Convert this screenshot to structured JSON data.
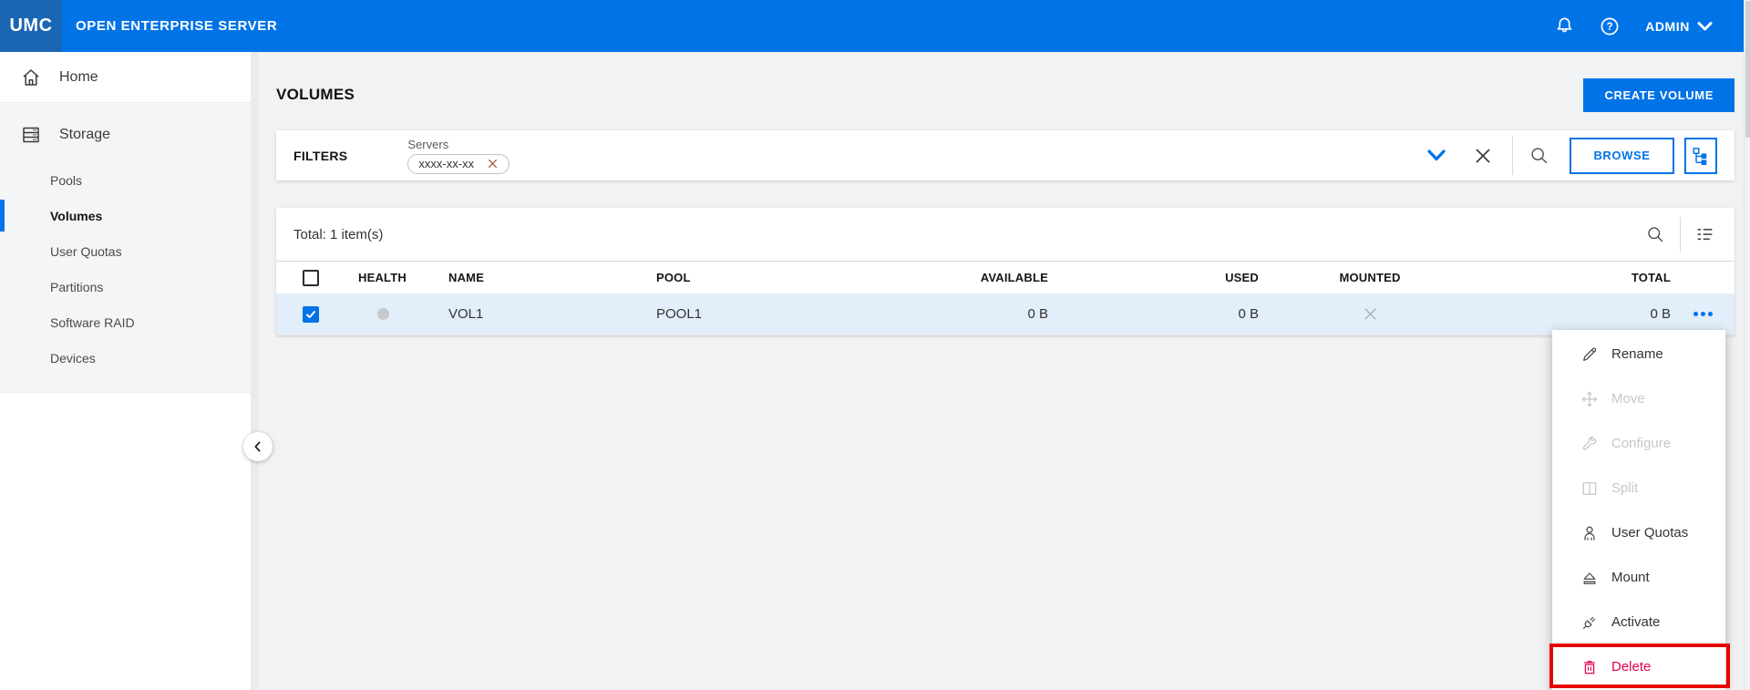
{
  "colors": {
    "accent": "#0073e7",
    "topbar": "#0073e7",
    "logo_bg": "#1a65b4",
    "danger": "#e5004c",
    "annotation": "#e60000",
    "row_selected": "#e2eef9",
    "main_bg": "#f1f2f4",
    "section_bg": "#f4f5f7"
  },
  "topbar": {
    "logo": "UMC",
    "product": "OPEN ENTERPRISE SERVER",
    "user": "ADMIN"
  },
  "sidebar": {
    "home_label": "Home",
    "sections": [
      {
        "label": "Storage",
        "items": [
          {
            "label": "Pools",
            "active": false
          },
          {
            "label": "Volumes",
            "active": true
          },
          {
            "label": "User Quotas",
            "active": false
          },
          {
            "label": "Partitions",
            "active": false
          },
          {
            "label": "Software RAID",
            "active": false
          },
          {
            "label": "Devices",
            "active": false
          }
        ]
      }
    ]
  },
  "page": {
    "title": "VOLUMES",
    "create_button": "CREATE VOLUME"
  },
  "filters": {
    "label": "FILTERS",
    "group_label": "Servers",
    "chip_value": "xxxx-xx-xx",
    "browse_button": "BROWSE"
  },
  "table": {
    "total": "Total: 1 item(s)",
    "columns": [
      "HEALTH",
      "NAME",
      "POOL",
      "AVAILABLE",
      "USED",
      "MOUNTED",
      "TOTAL"
    ],
    "rows": [
      {
        "selected": true,
        "health": "unknown",
        "name": "VOL1",
        "pool": "POOL1",
        "available": "0 B",
        "used": "0 B",
        "mounted": false,
        "total": "0 B"
      }
    ]
  },
  "context_menu": {
    "items": [
      {
        "label": "Rename",
        "icon": "pencil-icon",
        "enabled": true
      },
      {
        "label": "Move",
        "icon": "move-icon",
        "enabled": false
      },
      {
        "label": "Configure",
        "icon": "wrench-icon",
        "enabled": false
      },
      {
        "label": "Split",
        "icon": "split-icon",
        "enabled": false
      },
      {
        "label": "User Quotas",
        "icon": "user-icon",
        "enabled": true
      },
      {
        "label": "Mount",
        "icon": "eject-icon",
        "enabled": true
      },
      {
        "label": "Activate",
        "icon": "plug-icon",
        "enabled": true
      },
      {
        "label": "Delete",
        "icon": "trash-icon",
        "enabled": true,
        "danger": true,
        "highlighted": true
      }
    ]
  }
}
